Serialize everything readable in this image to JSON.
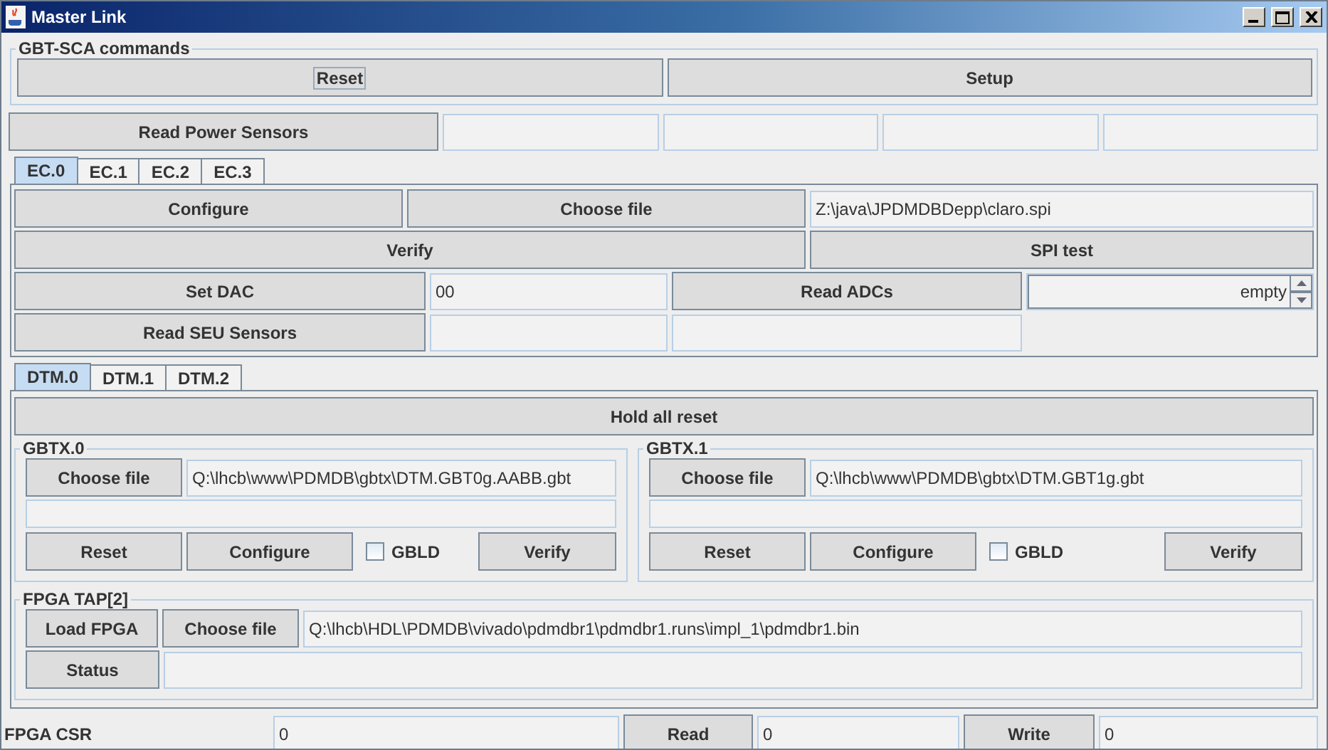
{
  "window": {
    "title": "Master Link"
  },
  "gbt_sca": {
    "title": "GBT-SCA commands",
    "reset_button": {
      "label": "Reset",
      "focused": true
    },
    "setup_button": {
      "label": "Setup",
      "focused": false
    }
  },
  "power": {
    "button": "Read Power Sensors"
  },
  "ec_tabs": [
    {
      "label": "EC.0",
      "selected": true
    },
    {
      "label": "EC.1",
      "selected": false
    },
    {
      "label": "EC.2",
      "selected": false
    },
    {
      "label": "EC.3",
      "selected": false
    }
  ],
  "ec_panel": {
    "configure_button": "Configure",
    "choose_file_button": "Choose file",
    "file_path": "Z:\\java\\JPDMDBDepp\\claro.spi",
    "verify_button": "Verify",
    "spi_test_button": "SPI test",
    "set_dac_button": "Set DAC",
    "dac_value": "00",
    "read_adcs_button": "Read ADCs",
    "adc_value": "empty",
    "read_seu_button": "Read SEU Sensors"
  },
  "dtm_tabs": [
    {
      "label": "DTM.0",
      "selected": true
    },
    {
      "label": "DTM.1",
      "selected": false
    },
    {
      "label": "DTM.2",
      "selected": false
    }
  ],
  "dtm_panel": {
    "hold_all_reset_button": "Hold all reset",
    "gbtx": [
      {
        "title": "GBTX.0",
        "choose_file_button": "Choose file",
        "file_path": "Q:\\lhcb\\www\\PDMDB\\gbtx\\DTM.GBT0g.AABB.gbt",
        "reset_button": "Reset",
        "configure_button": "Configure",
        "gbld": {
          "label": "GBLD",
          "checked": false
        },
        "verify_button": "Verify"
      },
      {
        "title": "GBTX.1",
        "choose_file_button": "Choose file",
        "file_path": "Q:\\lhcb\\www\\PDMDB\\gbtx\\DTM.GBT1g.gbt",
        "reset_button": "Reset",
        "configure_button": "Configure",
        "gbld": {
          "label": "GBLD",
          "checked": false
        },
        "verify_button": "Verify"
      }
    ],
    "fpga_tap": {
      "title": "FPGA TAP[2]",
      "load_button": "Load FPGA",
      "choose_file_button": "Choose file",
      "file_path": "Q:\\lhcb\\HDL\\PDMDB\\vivado\\pdmdbr1\\pdmdbr1.runs\\impl_1\\pdmdbr1.bin",
      "status_button": "Status"
    }
  },
  "fpga_csr": {
    "label": "FPGA CSR",
    "value": "0",
    "read_button": "Read",
    "read_value": "0",
    "write_button": "Write",
    "write_value": "0"
  }
}
